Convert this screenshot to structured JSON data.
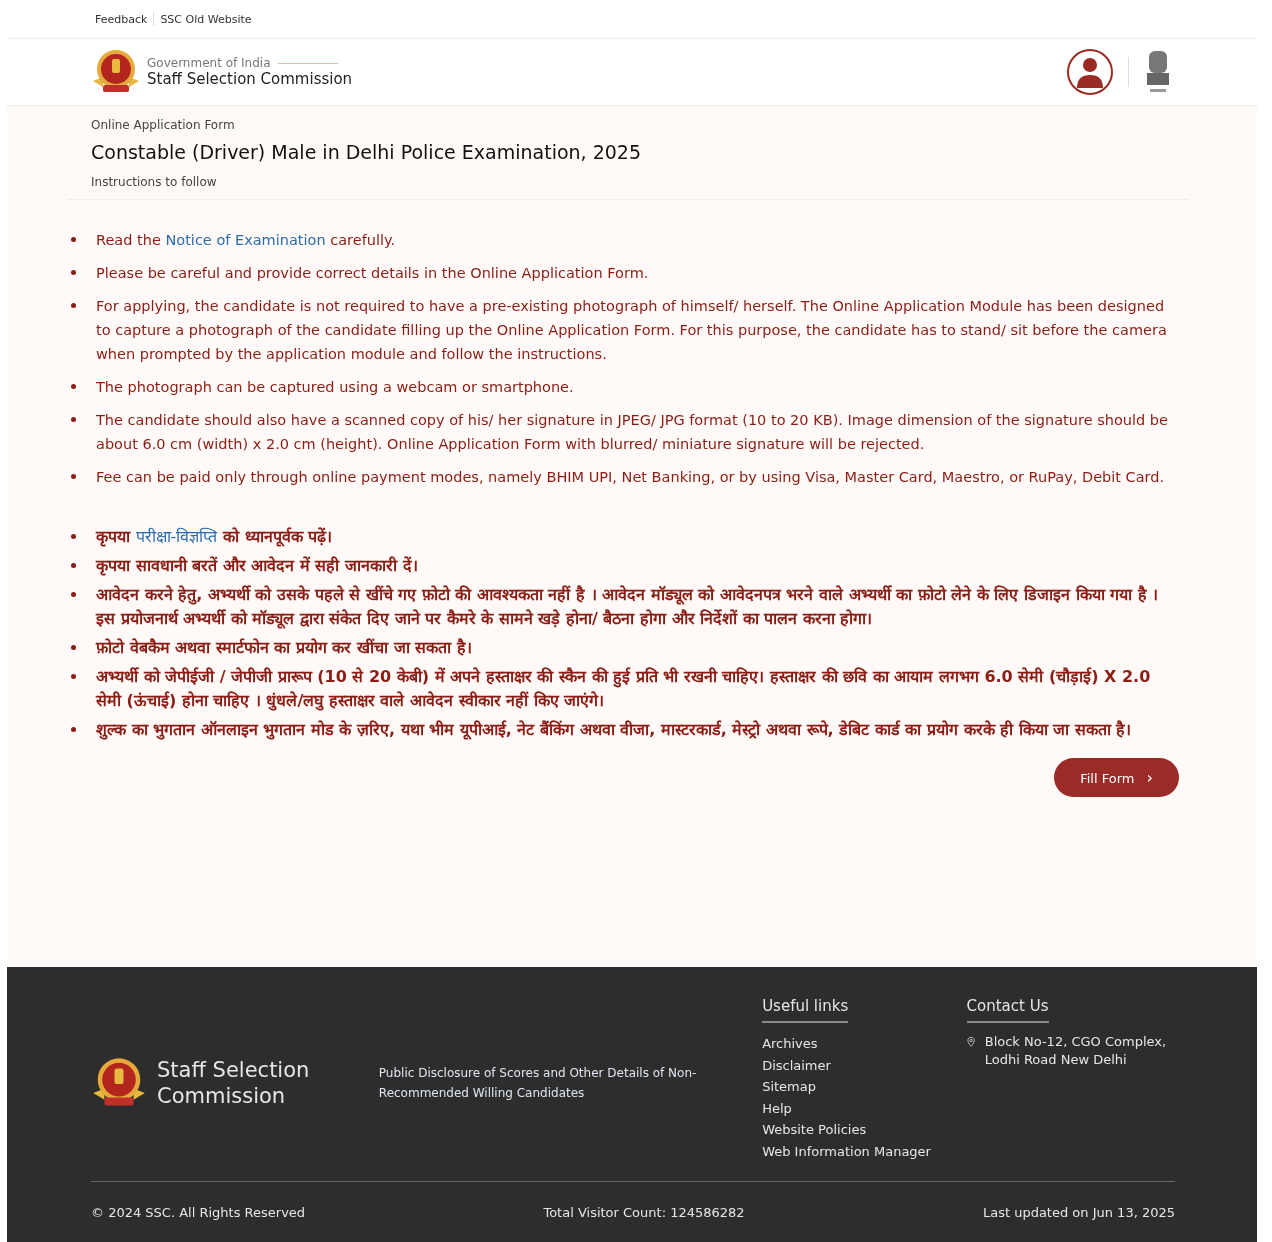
{
  "top_links": [
    "Feedback",
    "SSC Old Website"
  ],
  "header": {
    "subtitle": "Government of India",
    "title": "Staff Selection Commission"
  },
  "form": {
    "label": "Online Application Form",
    "title": "Constable (Driver) Male in Delhi Police Examination, 2025",
    "section": "Instructions to follow"
  },
  "instructions_en": [
    [
      {
        "text": "Read the ",
        "link": false
      },
      {
        "text": "Notice of Examination",
        "link": true
      },
      {
        "text": " carefully.",
        "link": false
      }
    ],
    [
      {
        "text": "Please be careful and provide correct details in the Online Application Form.",
        "link": false
      }
    ],
    [
      {
        "text": "For applying, the candidate is not required to have a pre-existing photograph of himself/ herself. The Online Application Module has been designed to capture a photograph of the candidate filling up the Online Application Form. For this purpose, the candidate has to stand/ sit before the camera when prompted by the application module and follow the instructions.",
        "link": false
      }
    ],
    [
      {
        "text": "The photograph can be captured using a webcam or smartphone.",
        "link": false
      }
    ],
    [
      {
        "text": "The candidate should also have a scanned copy of his/ her signature in JPEG/ JPG format (10 to 20 KB). Image dimension of the signature should be about 6.0 cm (width) x 2.0 cm (height). Online Application Form with blurred/ miniature signature will be rejected.",
        "link": false
      }
    ],
    [
      {
        "text": "Fee can be paid only through online payment modes, namely BHIM UPI, Net Banking, or by using Visa, Master Card, Maestro, or RuPay, Debit Card.",
        "link": false
      }
    ]
  ],
  "instructions_hi": [
    [
      {
        "text": "कृपया ",
        "link": false
      },
      {
        "text": "परीक्षा-विज्ञप्ति",
        "link": true
      },
      {
        "text": " को ध्यानपूर्वक पढ़ें।",
        "link": false
      }
    ],
    [
      {
        "text": "कृपया सावधानी बरतें और आवेदन में सही जानकारी दें।",
        "link": false
      }
    ],
    [
      {
        "text": "आवेदन करने हेतु, अभ्यर्थी को उसके पहले से खींचे गए फ़ोटो की आवश्यकता नहीं है । आवेदन मॉड्यूल को आवेदनपत्र भरने वाले अभ्यर्थी का फ़ोटो लेने के लिए डिजाइन किया गया है । इस प्रयोजनार्थ अभ्यर्थी को मॉड्यूल द्वारा संकेत दिए जाने पर कैमरे के सामने खड़े होना/ बैठना होगा और निर्देशों का पालन करना होगा।",
        "link": false
      }
    ],
    [
      {
        "text": "फ़ोटो वेबकैम अथवा स्मार्टफोन का प्रयोग कर खींचा जा सकता है।",
        "link": false
      }
    ],
    [
      {
        "text": "अभ्यर्थी को जेपीईजी / जेपीजी प्रारूप (10 से 20 केबी) में अपने हस्ताक्षर की स्कैन की हुई प्रति भी रखनी चाहिए। हस्ताक्षर की छवि का आयाम लगभग 6.0 सेमी (चौड़ाई) X 2.0 सेमी (ऊंचाई) होना चाहिए । धुंधले/लघु हस्ताक्षर वाले आवेदन स्वीकार नहीं किए जाएंगे।",
        "link": false
      }
    ],
    [
      {
        "text": "शुल्क का भुगतान ऑनलाइन भुगतान मोड के ज़रिए, यथा भीम यूपीआई, नेट बैंकिंग अथवा वीजा, मास्टरकार्ड, मेस्ट्रो अथवा रूपे, डेबिट कार्ड का प्रयोग करके ही किया जा सकता है।",
        "link": false
      }
    ]
  ],
  "fill_button": {
    "label": "Fill Form",
    "icon": "›"
  },
  "footer": {
    "brand": "Staff Selection Commission",
    "disclosure": "Public Disclosure of Scores and Other Details of Non-Recommended Willing Candidates",
    "useful_links": {
      "heading": "Useful links",
      "items": [
        "Archives",
        "Disclaimer",
        "Sitemap",
        "Help",
        "Website Policies",
        "Web Information Manager"
      ]
    },
    "contact": {
      "heading": "Contact Us",
      "address": "Block No-12, CGO Complex, Lodhi Road New Delhi"
    },
    "copyright": "© 2024 SSC. All Rights Reserved",
    "visitors": "Total Visitor Count: 124586282",
    "updated": "Last updated on Jun 13, 2025"
  }
}
